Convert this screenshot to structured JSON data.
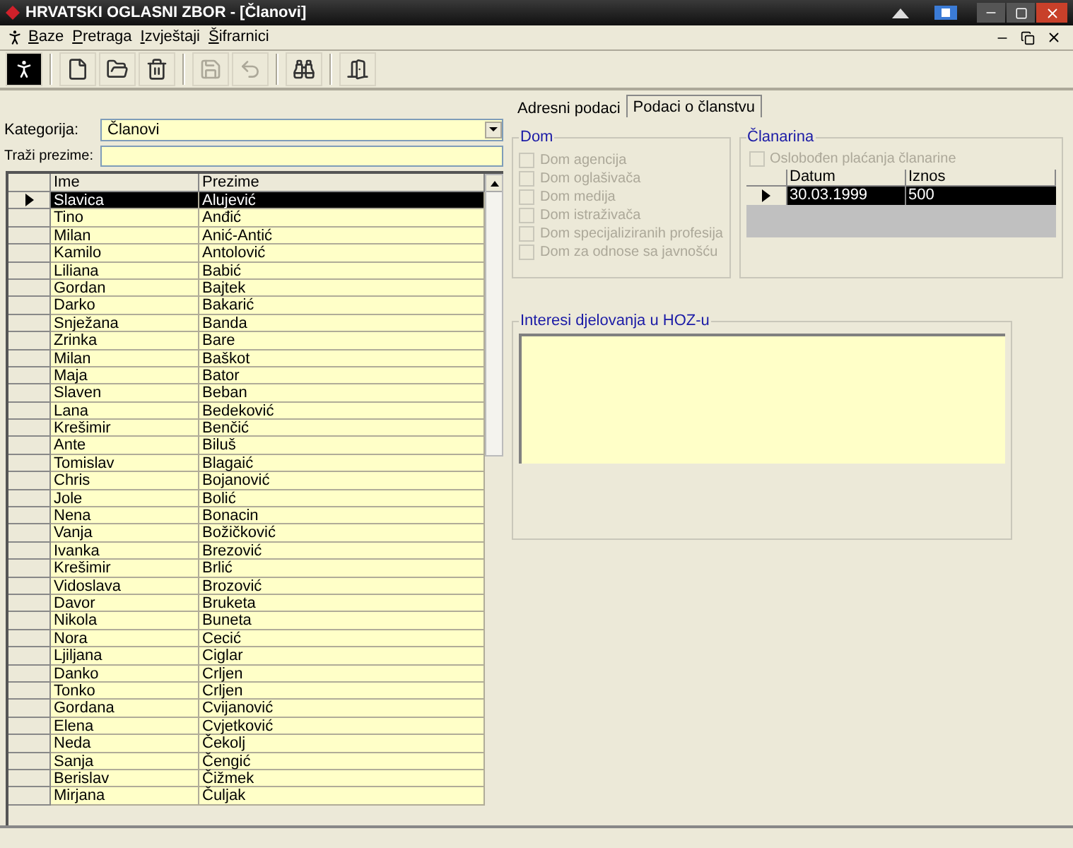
{
  "window": {
    "title": "HRVATSKI OGLASNI ZBOR - [Članovi]"
  },
  "menu": [
    {
      "label": "Baze"
    },
    {
      "label": "Pretraga"
    },
    {
      "label": "Izvještaji"
    },
    {
      "label": "Šifrarnici"
    }
  ],
  "toolbar": [
    {
      "kind": "exit",
      "disabled": false
    },
    {
      "kind": "new",
      "disabled": false
    },
    {
      "kind": "open",
      "disabled": false
    },
    {
      "kind": "delete",
      "disabled": false
    },
    {
      "kind": "save",
      "disabled": true
    },
    {
      "kind": "undo",
      "disabled": true
    },
    {
      "kind": "find",
      "disabled": false
    },
    {
      "kind": "door",
      "disabled": false
    }
  ],
  "filter": {
    "category_label": "Kategorija:",
    "category_value": "Članovi",
    "search_label": "Traži prezime:"
  },
  "members": {
    "columns": [
      "Ime",
      "Prezime"
    ],
    "rows": [
      {
        "cells": [
          "Slavica",
          "Alujević"
        ],
        "selected": true
      },
      {
        "cells": [
          "Tino",
          "Anđić"
        ],
        "selected": false
      },
      {
        "cells": [
          "Milan",
          "Anić-Antić"
        ],
        "selected": false
      },
      {
        "cells": [
          "Kamilo",
          "Antolović"
        ],
        "selected": false
      },
      {
        "cells": [
          "Liliana",
          "Babić"
        ],
        "selected": false
      },
      {
        "cells": [
          "Gordan",
          "Bajtek"
        ],
        "selected": false
      },
      {
        "cells": [
          "Darko",
          "Bakarić"
        ],
        "selected": false
      },
      {
        "cells": [
          "Snježana",
          "Banda"
        ],
        "selected": false
      },
      {
        "cells": [
          "Zrinka",
          "Bare"
        ],
        "selected": false
      },
      {
        "cells": [
          "Milan",
          "Baškot"
        ],
        "selected": false
      },
      {
        "cells": [
          "Maja",
          "Bator"
        ],
        "selected": false
      },
      {
        "cells": [
          "Slaven",
          "Beban"
        ],
        "selected": false
      },
      {
        "cells": [
          "Lana",
          "Bedeković"
        ],
        "selected": false
      },
      {
        "cells": [
          "Krešimir",
          "Benčić"
        ],
        "selected": false
      },
      {
        "cells": [
          "Ante",
          "Biluš"
        ],
        "selected": false
      },
      {
        "cells": [
          "Tomislav",
          "Blagaić"
        ],
        "selected": false
      },
      {
        "cells": [
          "Chris",
          "Bojanović"
        ],
        "selected": false
      },
      {
        "cells": [
          "Jole",
          "Bolić"
        ],
        "selected": false
      },
      {
        "cells": [
          "Nena",
          "Bonacin"
        ],
        "selected": false
      },
      {
        "cells": [
          "Vanja",
          "Božičković"
        ],
        "selected": false
      },
      {
        "cells": [
          "Ivanka",
          "Brezović"
        ],
        "selected": false
      },
      {
        "cells": [
          "Krešimir",
          "Brlić"
        ],
        "selected": false
      },
      {
        "cells": [
          "Vidoslava",
          "Brozović"
        ],
        "selected": false
      },
      {
        "cells": [
          "Davor",
          "Bruketa"
        ],
        "selected": false
      },
      {
        "cells": [
          "Nikola",
          "Buneta"
        ],
        "selected": false
      },
      {
        "cells": [
          "Nora",
          "Cecić"
        ],
        "selected": false
      },
      {
        "cells": [
          "Ljiljana",
          "Ciglar"
        ],
        "selected": false
      },
      {
        "cells": [
          "Danko",
          "Crljen"
        ],
        "selected": false
      },
      {
        "cells": [
          "Tonko",
          "Crljen"
        ],
        "selected": false
      },
      {
        "cells": [
          "Gordana",
          "Cvijanović"
        ],
        "selected": false
      },
      {
        "cells": [
          "Elena",
          "Cvjetković"
        ],
        "selected": false
      },
      {
        "cells": [
          "Neda",
          "Čekolj"
        ],
        "selected": false
      },
      {
        "cells": [
          "Sanja",
          "Čengić"
        ],
        "selected": false
      },
      {
        "cells": [
          "Berislav",
          "Čižmek"
        ],
        "selected": false
      },
      {
        "cells": [
          "Mirjana",
          "Čuljak"
        ],
        "selected": false
      }
    ]
  },
  "tabs": [
    {
      "label": "Adresni podaci",
      "selected": false
    },
    {
      "label": "Podaci o članstvu",
      "selected": true
    }
  ],
  "dom": {
    "title": "Dom",
    "disabled": true,
    "items": [
      {
        "label": "Dom agencija",
        "checked": false
      },
      {
        "label": "Dom oglašivača",
        "checked": false
      },
      {
        "label": "Dom medija",
        "checked": false
      },
      {
        "label": "Dom istraživača",
        "checked": false
      },
      {
        "label": "Dom specijaliziranih profesija",
        "checked": false
      },
      {
        "label": "Dom za odnose sa javnošću",
        "checked": false
      }
    ]
  },
  "clanarina": {
    "title": "Članarina",
    "exempt": {
      "label": "Oslobođen plaćanja članarine",
      "checked": false,
      "disabled": true
    },
    "columns": [
      "Datum",
      "Iznos"
    ],
    "rows": [
      {
        "cells": [
          "30.03.1999",
          "500"
        ],
        "selected": true
      }
    ]
  },
  "interests": {
    "title": "Interesi djelovanja u HOZ-u"
  }
}
